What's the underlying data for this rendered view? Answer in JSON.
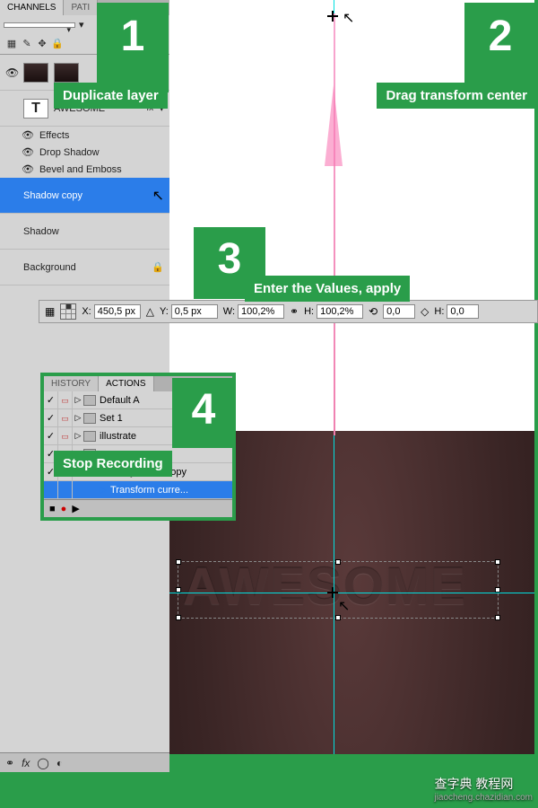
{
  "steps": [
    {
      "num": "1",
      "label": "Duplicate layer"
    },
    {
      "num": "2",
      "label": "Drag transform center"
    },
    {
      "num": "3",
      "label": "Enter the Values, apply"
    },
    {
      "num": "4",
      "label": "Stop Recording"
    }
  ],
  "layers_panel": {
    "tab1": "CHANNELS",
    "tab2": "PATI",
    "blend_mode": "",
    "layers": {
      "awesome": "AWESOME",
      "fx": "fx",
      "effects": "Effects",
      "drop_shadow": "Drop Shadow",
      "bevel": "Bevel and Emboss",
      "shadow_copy": "Shadow copy",
      "shadow": "Shadow",
      "background": "Background"
    }
  },
  "options_bar": {
    "x_label": "X:",
    "x_value": "450,5 px",
    "y_label": "Y:",
    "y_value": "0,5 px",
    "w_label": "W:",
    "w_value": "100,2%",
    "h_label": "H:",
    "h_value": "100,2%",
    "rot_value": "0,0",
    "skew_label": "H:",
    "skew_value": "0,0"
  },
  "actions_panel": {
    "tab1": "HISTORY",
    "tab2": "ACTIONS",
    "items": {
      "default": "Default A",
      "set1": "Set 1",
      "illustrate": "illustrate",
      "layer_via_copy": "Layer Via Copy",
      "transform": "Transform curre..."
    }
  },
  "canvas_text": "AWESOME",
  "watermark": {
    "main": "查字典 教程网",
    "url": "jiaocheng.chazidian.com"
  }
}
